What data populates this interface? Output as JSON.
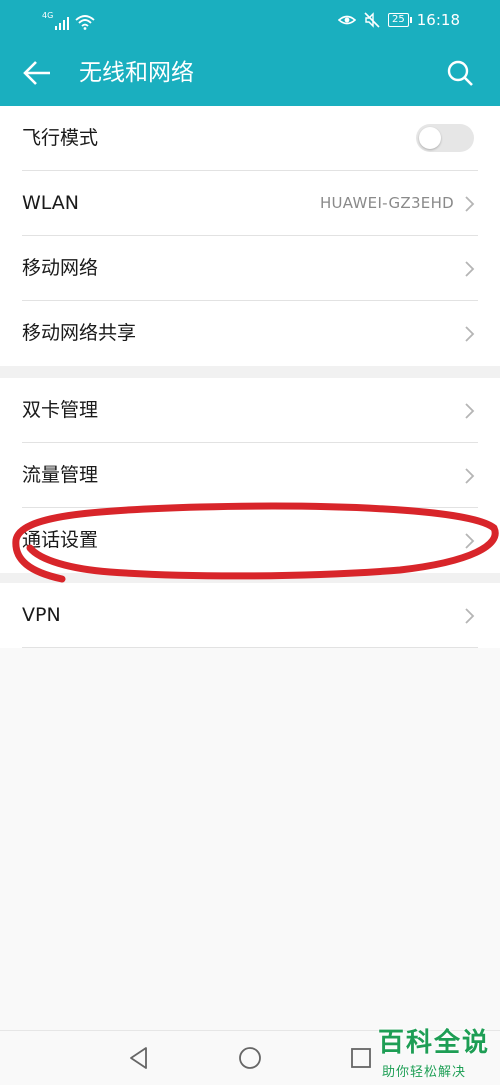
{
  "status_bar": {
    "network_type": "4G",
    "battery": "25",
    "time": "16:18"
  },
  "app_bar": {
    "title": "无线和网络"
  },
  "sections": [
    {
      "items": [
        {
          "label": "飞行模式",
          "control": "toggle",
          "toggle_on": false
        },
        {
          "label": "WLAN",
          "value": "HUAWEI-GZ3EHD",
          "control": "chevron"
        },
        {
          "label": "移动网络",
          "control": "chevron"
        },
        {
          "label": "移动网络共享",
          "control": "chevron"
        }
      ]
    },
    {
      "items": [
        {
          "label": "双卡管理",
          "control": "chevron"
        },
        {
          "label": "流量管理",
          "control": "chevron"
        },
        {
          "label": "通话设置",
          "control": "chevron"
        }
      ]
    },
    {
      "items": [
        {
          "label": "VPN",
          "control": "chevron"
        }
      ]
    }
  ],
  "annotation": {
    "color": "#d8252a",
    "target": "通话设置"
  },
  "watermark": {
    "title": "百科全说",
    "subtitle": "助你轻松解决",
    "color": "#1e9e55"
  },
  "colors": {
    "accent": "#1aafbf"
  }
}
